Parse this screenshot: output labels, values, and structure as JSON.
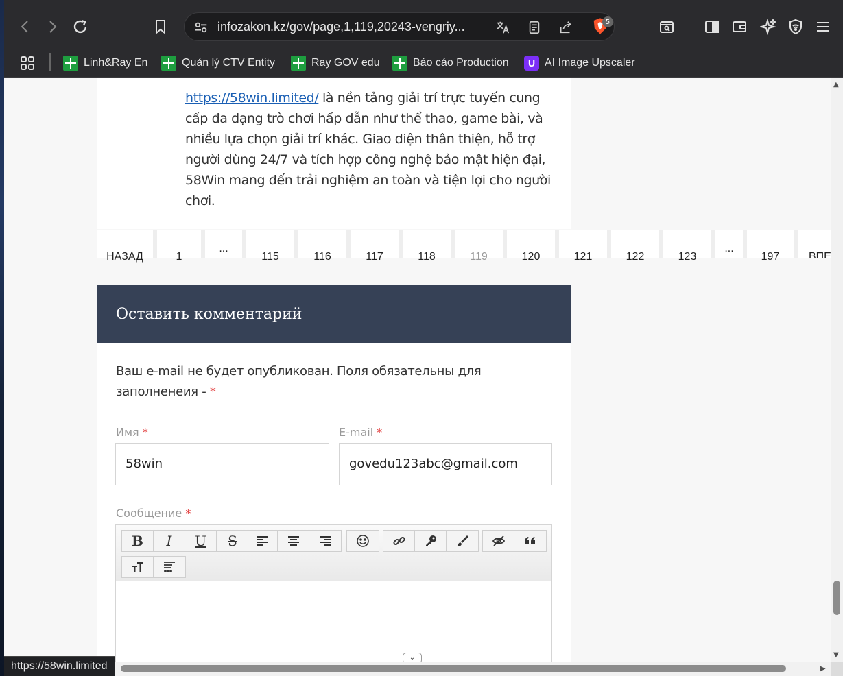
{
  "browser": {
    "url": "infozakon.kz/gov/page,1,119,20243-vengriy...",
    "shield_count": "5"
  },
  "bookmarks": {
    "items": [
      {
        "label": "Linh&Ray En"
      },
      {
        "label": "Quản lý CTV Entity"
      },
      {
        "label": "Ray GOV edu"
      },
      {
        "label": "Báo cáo Production"
      },
      {
        "label": "AI Image Upscaler"
      }
    ]
  },
  "article": {
    "link_text": "https://58win.limited/",
    "body_text": " là nền tảng giải trí trực tuyến cung cấp đa dạng trò chơi hấp dẫn như thể thao, game bài, và nhiều lựa chọn giải trí khác. Giao diện thân thiện, hỗ trợ người dùng 24/7 và tích hợp công nghệ bảo mật hiện đại, 58Win mang đến trải nghiệm an toàn và tiện lợi cho người chơi."
  },
  "pagination": {
    "prev": "НАЗАД",
    "pages": [
      "1",
      "...",
      "115",
      "116",
      "117",
      "118",
      "119",
      "120",
      "121",
      "122",
      "123",
      "...",
      "197"
    ],
    "current": "119",
    "next": "ВПЕРЕД"
  },
  "comment_form": {
    "title": "Оставить комментарий",
    "notice": "Ваш e-mail не будет опубликован. Поля обязательны для заполненеия - ",
    "required_mark": "*",
    "name_label": "Имя",
    "name_value": "58win",
    "email_label": "E-mail",
    "email_value": "govedu123abc@gmail.com",
    "message_label": "Сообщение"
  },
  "status_bar": {
    "hover_url": "https://58win.limited"
  }
}
